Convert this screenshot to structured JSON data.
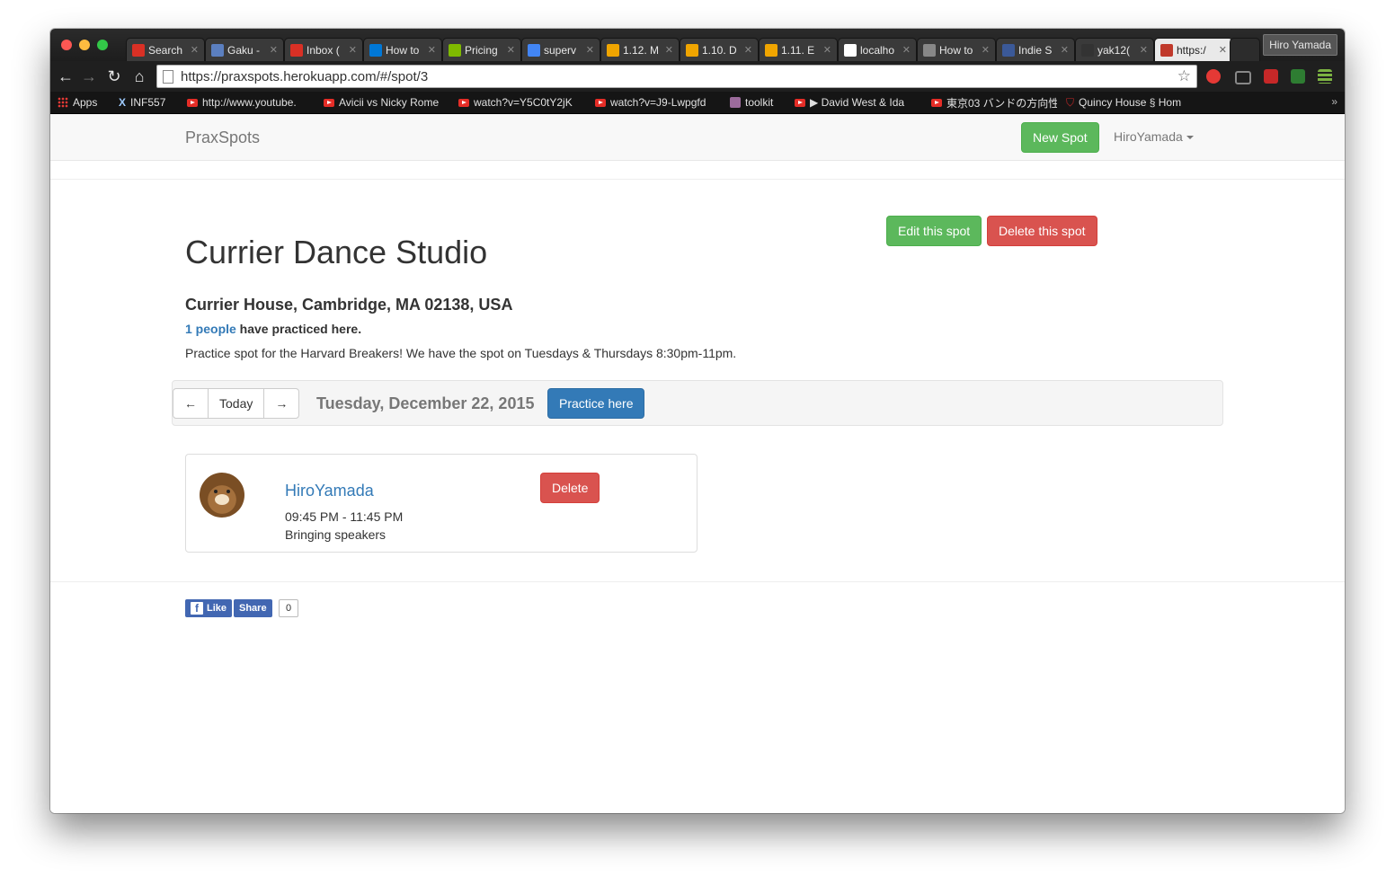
{
  "browser": {
    "tabs": [
      {
        "title": "Search",
        "icon": "gmail-icon",
        "color": "#d93025"
      },
      {
        "title": "Gaku -",
        "icon": "gaku-icon",
        "color": "#5b7fbf"
      },
      {
        "title": "Inbox (",
        "icon": "gmail-icon",
        "color": "#d93025"
      },
      {
        "title": "How to",
        "icon": "windows-icon",
        "color": "#0078d7"
      },
      {
        "title": "Pricing",
        "icon": "windows-icon",
        "color": "#7fba00"
      },
      {
        "title": "superv",
        "icon": "google-icon",
        "color": "#4285f4"
      },
      {
        "title": "1.12. M",
        "icon": "doc-icon",
        "color": "#f0a500"
      },
      {
        "title": "1.10. D",
        "icon": "doc-icon",
        "color": "#f0a500"
      },
      {
        "title": "1.11. E",
        "icon": "doc-icon",
        "color": "#f0a500"
      },
      {
        "title": "localho",
        "icon": "t-icon",
        "color": "#ffffff"
      },
      {
        "title": "How to",
        "icon": "page-icon",
        "color": "#888888"
      },
      {
        "title": "Indie S",
        "icon": "facebook-icon",
        "color": "#3b5998"
      },
      {
        "title": "yak12(",
        "icon": "github-icon",
        "color": "#333333"
      },
      {
        "title": "https:/",
        "icon": "praxspots-icon",
        "color": "#c0392b"
      }
    ],
    "profile_name": "Hiro Yamada",
    "url": "https://praxspots.herokuapp.com/#/spot/3",
    "bookmarks": [
      {
        "label": "Apps",
        "icon": "apps-grid-icon"
      },
      {
        "label": "INF557",
        "icon": "x-icon"
      },
      {
        "label": "http://www.youtube.",
        "icon": "youtube-icon"
      },
      {
        "label": "Avicii vs Nicky Rome",
        "icon": "youtube-icon"
      },
      {
        "label": "watch?v=Y5C0tY2jK",
        "icon": "youtube-icon"
      },
      {
        "label": "watch?v=J9-Lwpgfd",
        "icon": "youtube-icon"
      },
      {
        "label": "toolkit",
        "icon": "toolkit-icon"
      },
      {
        "label": "▶ David West & Ida",
        "icon": "youtube-icon"
      },
      {
        "label": "東京03 バンドの方向性",
        "icon": "youtube-icon"
      },
      {
        "label": "Quincy House § Hom",
        "icon": "shield-icon"
      }
    ],
    "bookmarks_more": "»"
  },
  "navbar": {
    "brand": "PraxSpots",
    "new_spot": "New Spot",
    "user": "HiroYamada"
  },
  "spot": {
    "name": "Currier Dance Studio",
    "address": "Currier House, Cambridge, MA 02138, USA",
    "people_count_link": "1 people",
    "practiced_suffix": " have practiced here.",
    "description": "Practice spot for the Harvard Breakers! We have the spot on Tuesdays & Thursdays 8:30pm-11pm.",
    "edit_label": "Edit this spot",
    "delete_label": "Delete this spot"
  },
  "date_nav": {
    "prev": "←",
    "today": "Today",
    "next": "→",
    "date": "Tuesday, December 22, 2015",
    "practice_here": "Practice here"
  },
  "sessions": [
    {
      "user": "HiroYamada",
      "time": "09:45 PM - 11:45 PM",
      "note": "Bringing speakers",
      "delete_label": "Delete"
    }
  ],
  "social": {
    "like": "Like",
    "share": "Share",
    "count": "0"
  },
  "colors": {
    "success": "#5cb85c",
    "danger": "#d9534f",
    "primary": "#337ab7",
    "facebook": "#4267b2"
  }
}
